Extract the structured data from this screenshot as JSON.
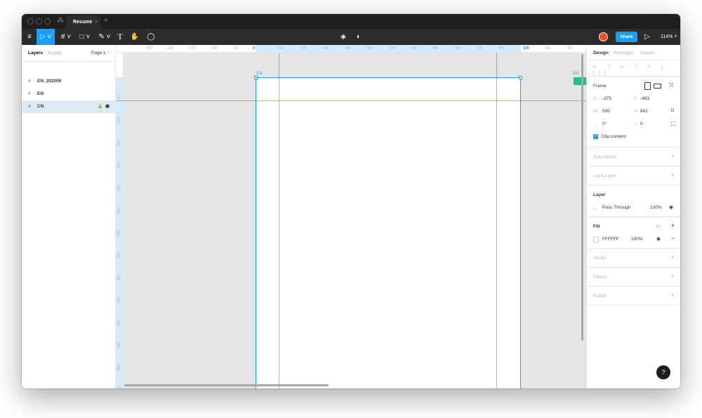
{
  "window": {
    "tab_title": "Resume",
    "tab_close": "×",
    "new_tab": "+"
  },
  "toolbar": {
    "menu_icon": "≡",
    "move_tool": "▷ ˅",
    "frame_tool": "# ˅",
    "shape_tool": "□ ˅",
    "pen_tool": "✎ ˅",
    "text_tool": "T",
    "hand_tool": "✋",
    "comment_tool": "◯",
    "components_icon": "◈",
    "theme_icon": "◐",
    "share_label": "Share",
    "present_icon": "▷",
    "zoom_level": "114%",
    "zoom_caret": "˅"
  },
  "left_panel": {
    "tabs": [
      "Layers",
      "Assets"
    ],
    "page_selector": "Page 1",
    "page_caret": "˅",
    "layers": [
      {
        "name": "EN_202009",
        "icon": "#"
      },
      {
        "name": "EN",
        "icon": "#"
      },
      {
        "name": "CN",
        "icon": "#",
        "selected": true,
        "lock": "🔓",
        "eye": "◉"
      }
    ]
  },
  "canvas": {
    "ruler_top_ticks": [
      "-250",
      "-200",
      "-150",
      "-100",
      "-50",
      "0",
      "50",
      "100",
      "150",
      "200",
      "250",
      "300",
      "350",
      "400",
      "450",
      "500",
      "550",
      "595",
      "650",
      "700"
    ],
    "ruler_left_ticks": [
      "50",
      "100",
      "150",
      "200",
      "250",
      "300",
      "350",
      "400",
      "450",
      "500",
      "550",
      "600",
      "650",
      "700"
    ],
    "frame_label": "CN",
    "right_frame_label": "EN"
  },
  "right_panel": {
    "tabs": [
      "Design",
      "Prototype",
      "Inspect"
    ],
    "align_icons": "⊨ ⊤ ⊫ ⊤ ⫩ ⊥ |||",
    "frame_selector": "Frame",
    "x_label": "X",
    "x_value": "-375",
    "y_label": "Y",
    "y_value": "-483",
    "w_label": "W",
    "w_value": "595",
    "h_label": "H",
    "h_value": "842",
    "rotation_label": "∟",
    "rotation_value": "0°",
    "radius_label": "◠",
    "radius_value": "0",
    "clip_content_label": "Clip content",
    "auto_layout": "Auto layout",
    "layout_grid": "Layout grid",
    "layer_section": "Layer",
    "blend_mode": "Pass Through",
    "layer_opacity": "100%",
    "fill_section": "Fill",
    "fill_hex": "FFFFFF",
    "fill_opacity": "100%",
    "stroke": "Stroke",
    "effects": "Effects",
    "export": "Export",
    "plus": "+",
    "minus": "−",
    "help": "?"
  },
  "colors": {
    "accent": "#18a0fb",
    "toolbar_bg": "#2c2c2c",
    "titlebar_bg": "#1e1e1e",
    "canvas_bg": "#e5e5e5",
    "guide_red": "#f24822",
    "component_green": "#1bc47d"
  }
}
